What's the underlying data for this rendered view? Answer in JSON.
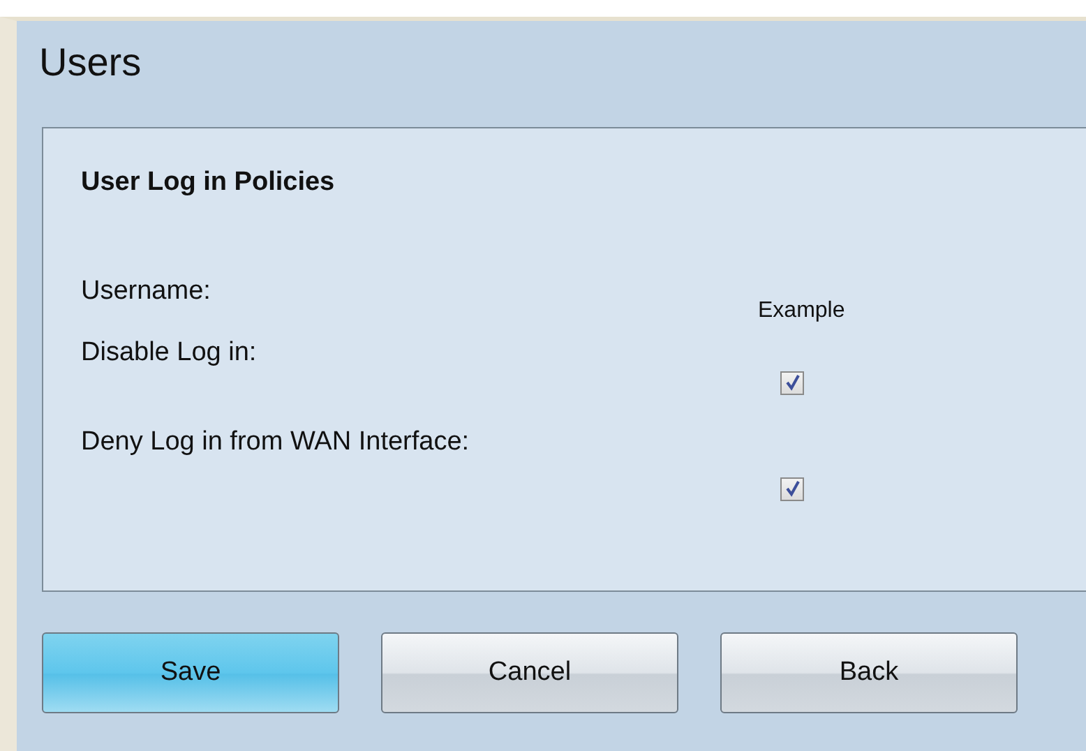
{
  "page": {
    "title": "Users"
  },
  "section": {
    "title": "User Log in Policies",
    "fields": [
      {
        "kind": "text",
        "label": "Username:",
        "value": "Example"
      },
      {
        "kind": "checkbox",
        "label": "Disable Log in:",
        "checked": true
      },
      {
        "kind": "checkbox",
        "label": "Deny Log in from WAN Interface:",
        "checked": true
      }
    ]
  },
  "buttons": [
    {
      "label": "Save",
      "kind": "primary"
    },
    {
      "label": "Cancel",
      "kind": "default"
    },
    {
      "label": "Back",
      "kind": "default"
    }
  ]
}
